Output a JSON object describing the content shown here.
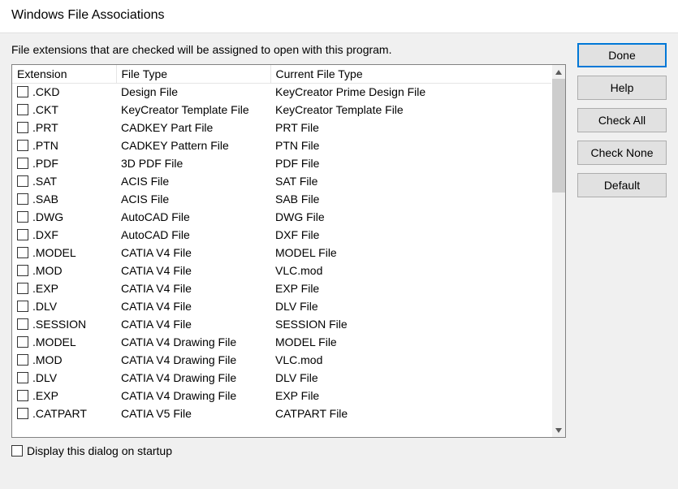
{
  "title": "Windows File Associations",
  "intro": "File extensions that are checked will be assigned to open with this program.",
  "columns": {
    "ext": "Extension",
    "type": "File Type",
    "current": "Current File Type"
  },
  "rows": [
    {
      "ext": ".CKD",
      "type": "Design File",
      "current": "KeyCreator Prime Design File"
    },
    {
      "ext": ".CKT",
      "type": "KeyCreator Template File",
      "current": "KeyCreator Template File"
    },
    {
      "ext": ".PRT",
      "type": "CADKEY Part File",
      "current": "PRT File"
    },
    {
      "ext": ".PTN",
      "type": "CADKEY Pattern File",
      "current": "PTN File"
    },
    {
      "ext": ".PDF",
      "type": "3D PDF File",
      "current": "PDF File"
    },
    {
      "ext": ".SAT",
      "type": "ACIS File",
      "current": "SAT File"
    },
    {
      "ext": ".SAB",
      "type": "ACIS File",
      "current": "SAB File"
    },
    {
      "ext": ".DWG",
      "type": "AutoCAD File",
      "current": "DWG File"
    },
    {
      "ext": ".DXF",
      "type": "AutoCAD File",
      "current": "DXF File"
    },
    {
      "ext": ".MODEL",
      "type": "CATIA V4 File",
      "current": "MODEL File"
    },
    {
      "ext": ".MOD",
      "type": "CATIA V4 File",
      "current": "VLC.mod"
    },
    {
      "ext": ".EXP",
      "type": "CATIA V4 File",
      "current": "EXP File"
    },
    {
      "ext": ".DLV",
      "type": "CATIA V4 File",
      "current": "DLV File"
    },
    {
      "ext": ".SESSION",
      "type": "CATIA V4 File",
      "current": "SESSION File"
    },
    {
      "ext": ".MODEL",
      "type": "CATIA V4 Drawing File",
      "current": "MODEL File"
    },
    {
      "ext": ".MOD",
      "type": "CATIA V4 Drawing File",
      "current": "VLC.mod"
    },
    {
      "ext": ".DLV",
      "type": "CATIA V4 Drawing File",
      "current": "DLV File"
    },
    {
      "ext": ".EXP",
      "type": "CATIA V4 Drawing File",
      "current": "EXP File"
    },
    {
      "ext": ".CATPART",
      "type": "CATIA V5 File",
      "current": "CATPART File"
    }
  ],
  "buttons": {
    "done": "Done",
    "help": "Help",
    "check_all": "Check All",
    "check_none": "Check None",
    "default": "Default"
  },
  "startup_label": "Display this dialog on startup"
}
